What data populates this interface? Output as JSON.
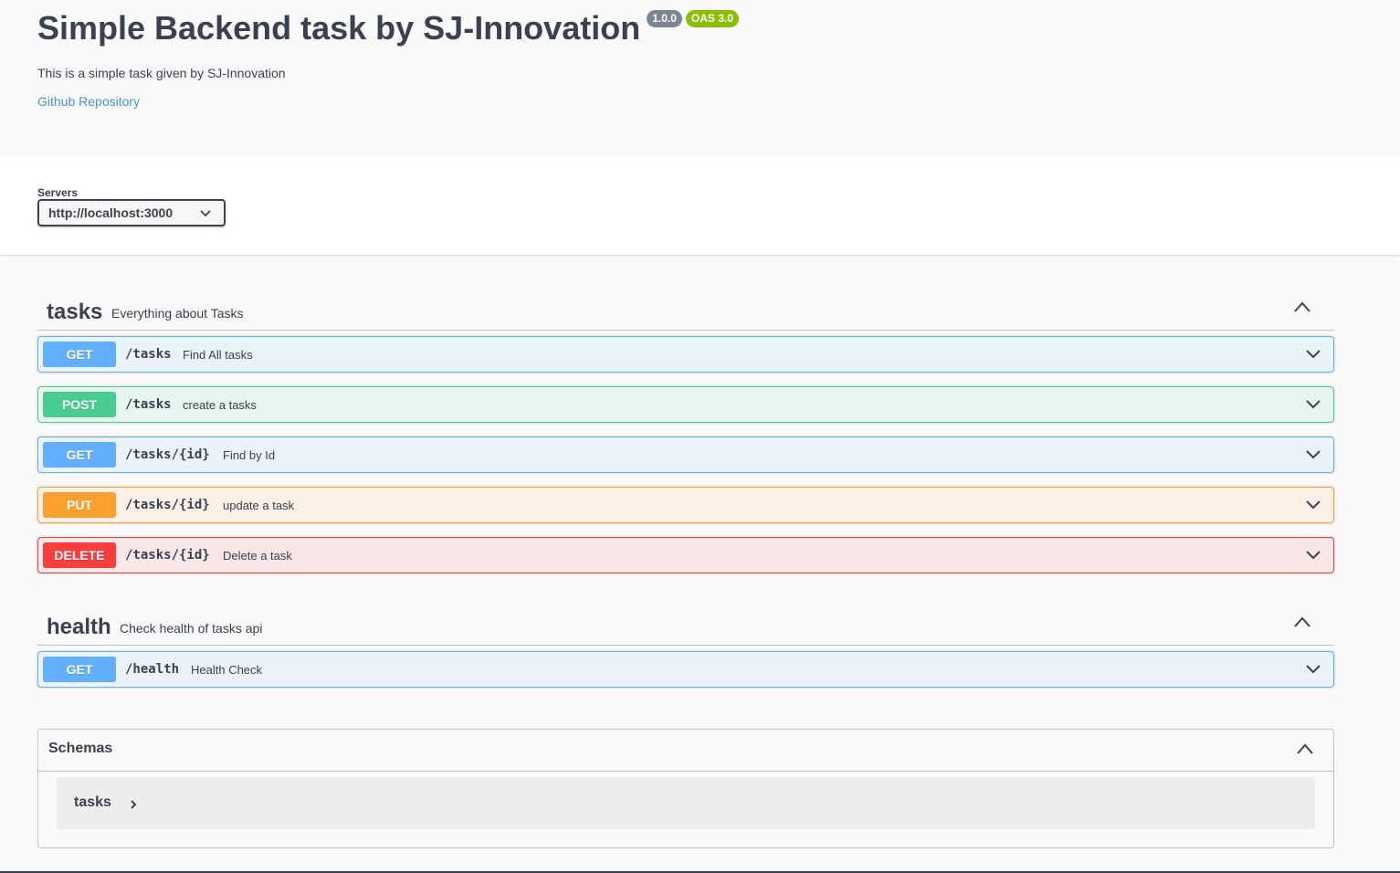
{
  "info": {
    "title": "Simple Backend task by SJ-Innovation",
    "version": "1.0.0",
    "oas": "OAS 3.0",
    "description": "This is a simple task given by SJ-Innovation",
    "repo_link": "Github Repository"
  },
  "servers": {
    "label": "Servers",
    "selected": "http://localhost:3000"
  },
  "tags": [
    {
      "name": "tasks",
      "description": "Everything about Tasks",
      "operations": [
        {
          "method": "GET",
          "path": "/tasks",
          "summary": "Find All tasks"
        },
        {
          "method": "POST",
          "path": "/tasks",
          "summary": "create a tasks"
        },
        {
          "method": "GET",
          "path": "/tasks/{id}",
          "summary": "Find by Id"
        },
        {
          "method": "PUT",
          "path": "/tasks/{id}",
          "summary": "update a task"
        },
        {
          "method": "DELETE",
          "path": "/tasks/{id}",
          "summary": "Delete a task"
        }
      ]
    },
    {
      "name": "health",
      "description": "Check health of tasks api",
      "operations": [
        {
          "method": "GET",
          "path": "/health",
          "summary": "Health Check"
        }
      ]
    }
  ],
  "schemas": {
    "title": "Schemas",
    "models": [
      "tasks"
    ]
  },
  "icons": {
    "tag_toggle": "chevron-up-icon",
    "op_toggle": "chevron-down-icon",
    "model_toggle": "chevron-right-icon"
  },
  "colors": {
    "get": "#61affe",
    "post": "#49cc90",
    "put": "#fca130",
    "delete": "#f93e3e",
    "link": "#4990e2",
    "version_badge": "#7d8492",
    "oas_badge": "#89bf04"
  }
}
